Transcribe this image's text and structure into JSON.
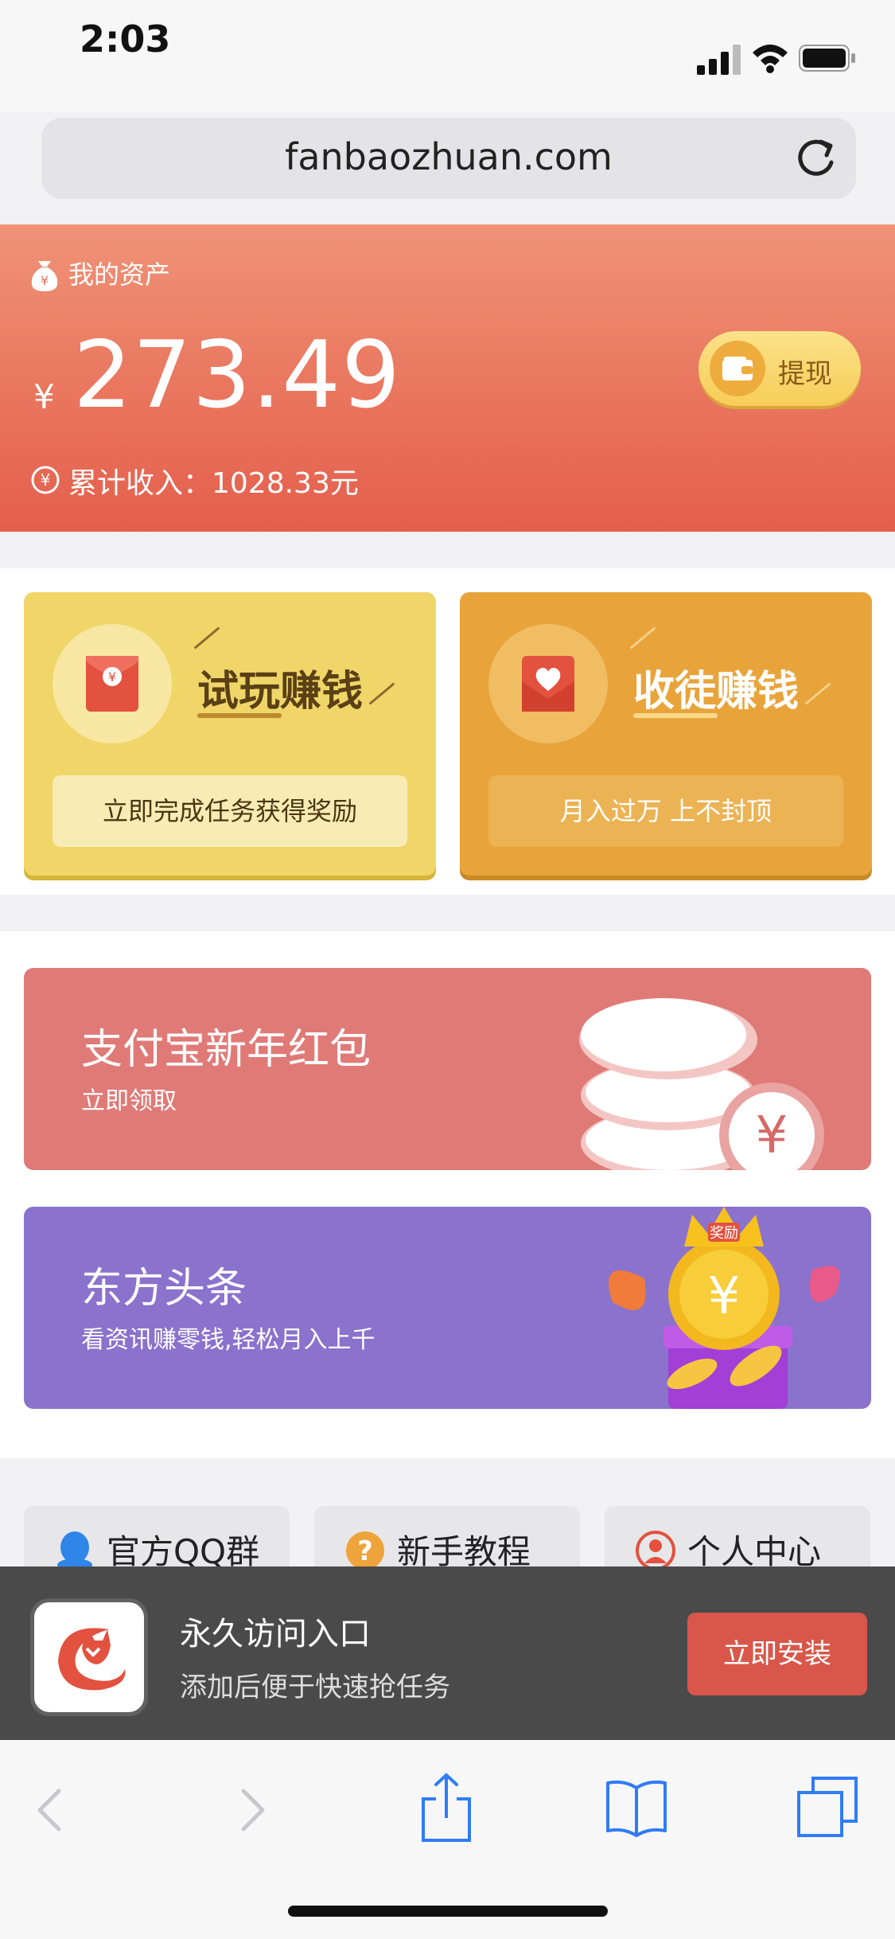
{
  "status_bar": {
    "time": "2:03"
  },
  "browser": {
    "url": "fanbaozhuan.com"
  },
  "assets": {
    "label": "我的资产",
    "currency_symbol": "¥",
    "balance": "273.49",
    "withdraw_label": "提现",
    "total_income": "累计收入：1028.33元"
  },
  "tiles": [
    {
      "title": "试玩赚钱",
      "subtitle": "立即完成任务获得奖励",
      "color": "#f0d669"
    },
    {
      "title": "收徒赚钱",
      "subtitle": "月入过万 上不封顶",
      "color": "#e8a43b"
    }
  ],
  "banners": [
    {
      "title": "支付宝新年红包",
      "subtitle": "立即领取",
      "color": "#e07a77",
      "icon": "coin-stack-icon"
    },
    {
      "title": "东方头条",
      "subtitle": "看资讯赚零钱,轻松月入上千",
      "color": "#8a72cd",
      "icon": "treasure-chest-icon"
    }
  ],
  "treasure_text": "奖励",
  "quick_links": [
    {
      "label": "官方QQ群",
      "icon": "qq-penguin-icon"
    },
    {
      "label": "新手教程",
      "icon": "question-icon"
    },
    {
      "label": "个人中心",
      "icon": "user-icon"
    }
  ],
  "install_banner": {
    "title": "永久访问入口",
    "subtitle": "添加后便于快速抢任务",
    "button": "立即安装",
    "accent": "#d9574a"
  },
  "toolbar": {
    "items": [
      "back-icon",
      "forward-icon",
      "share-icon",
      "bookmarks-icon",
      "tabs-icon"
    ]
  }
}
